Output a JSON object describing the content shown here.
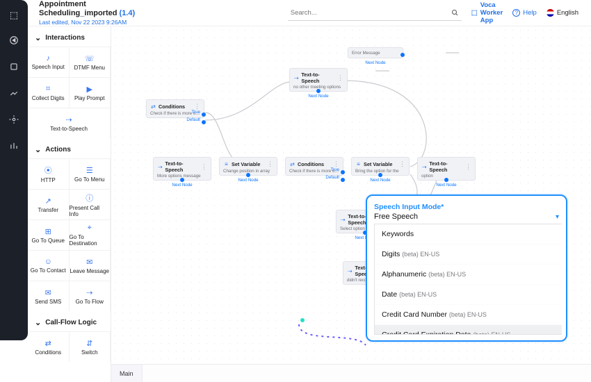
{
  "header": {
    "title": "Appointment Scheduling_imported",
    "version": "(1.4)",
    "last_edited": "Last edited, Nov 22 2023 9:26AM",
    "search_placeholder": "Search...",
    "app_switch": "Voca Worker App",
    "help": "Help",
    "language": "English"
  },
  "palette": {
    "sections": {
      "interactions": {
        "title": "Interactions",
        "items": [
          "Speech Input",
          "DTMF Menu",
          "Collect Digits",
          "Play Prompt",
          "Text-to-Speech"
        ]
      },
      "actions": {
        "title": "Actions",
        "items": [
          "HTTP",
          "Go To Menu",
          "Transfer",
          "Present Call Info",
          "Go To Queue",
          "Go To Destination",
          "Go To Contact",
          "Leave Message",
          "Send SMS",
          "Go To Flow"
        ]
      },
      "logic": {
        "title": "Call-Flow Logic",
        "items": [
          "Conditions",
          "Switch"
        ]
      }
    }
  },
  "nodes": {
    "errmsg": {
      "title": "",
      "sub": "Error Message",
      "nn": "Next Node"
    },
    "tts_top": {
      "title": "Text-to-Speech",
      "sub": "no other meeting options",
      "nn": "Next Node"
    },
    "cond1": {
      "title": "Conditions",
      "sub": "Check if there is more op…",
      "p1": "True",
      "p2": "Default"
    },
    "tts_more": {
      "title": "Text-to-Speech",
      "sub": "More options message",
      "nn": "Next Node"
    },
    "setv1": {
      "title": "Set Variable",
      "sub": "Change position in array",
      "nn": "Next Node"
    },
    "cond2": {
      "title": "Conditions",
      "sub": "Check if there is more op…",
      "p1": "True",
      "p2": "Default"
    },
    "setv2": {
      "title": "Set Variable",
      "sub": "Bring the option for the",
      "nn": "Next Node"
    },
    "tts_opt": {
      "title": "Text-to-Speech",
      "sub": "option",
      "nn": "Next Node"
    },
    "tts_sel": {
      "title": "Text-to-Speech",
      "sub": "Select option message",
      "nn": "Next Node"
    },
    "tts_rec": {
      "title": "Text-to-Speech",
      "sub": "didn't recognize"
    }
  },
  "tabs": {
    "main": "Main"
  },
  "dropdown": {
    "label": "Speech Input Mode*",
    "selected": "Free Speech",
    "options": [
      {
        "name": "Keywords",
        "beta": ""
      },
      {
        "name": "Digits",
        "beta": "(beta) EN-US"
      },
      {
        "name": "Alphanumeric",
        "beta": "(beta) EN-US"
      },
      {
        "name": "Date",
        "beta": "(beta) EN-US"
      },
      {
        "name": "Credit Card Number",
        "beta": "(beta) EN-US"
      },
      {
        "name": "Credit Card Expiration Date",
        "beta": "(beta) EN-US"
      }
    ],
    "highlighted_index": 5
  }
}
